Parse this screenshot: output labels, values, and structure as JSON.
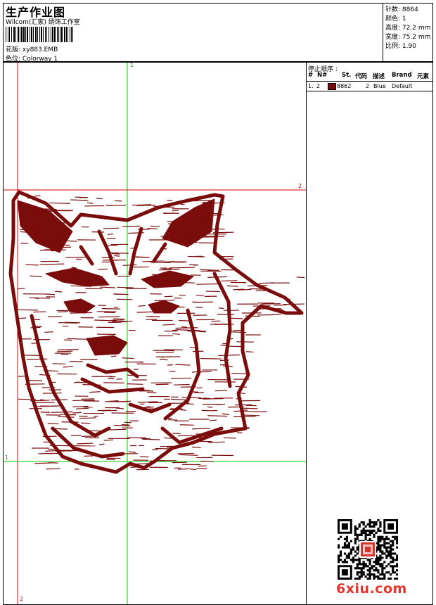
{
  "header": {
    "title": "生产作业图",
    "company": "Wilcom(汇家) 绣饰工作室",
    "design_label": "花版:",
    "design_value": "xy883.EMB",
    "colorway_label": "色位:",
    "colorway_value": "Colorway 1"
  },
  "stats": [
    {
      "label": "针数:",
      "value": "8864"
    },
    {
      "label": "颜色:",
      "value": "1"
    },
    {
      "label": "高度:",
      "value": "72.2 mm"
    },
    {
      "label": "宽度:",
      "value": "75.2 mm"
    },
    {
      "label": "比例:",
      "value": "1.90"
    }
  ],
  "stop_panel": {
    "title": "停止顺序 :",
    "columns": [
      "#",
      "N#",
      "St.",
      "代码",
      "描述",
      "Brand",
      "元素"
    ],
    "rows": [
      {
        "index": "1.",
        "needle": "2",
        "stitches": "8862",
        "code": "2",
        "description": "Blue",
        "brand": "Default",
        "swatch": "#7a0c0c"
      }
    ]
  },
  "guides": {
    "v1_label": "1",
    "h2_label": "2",
    "h1_label": "1",
    "v2_label": "2"
  },
  "thread_color": "#7a0c0c",
  "watermark": "6xiu.com"
}
